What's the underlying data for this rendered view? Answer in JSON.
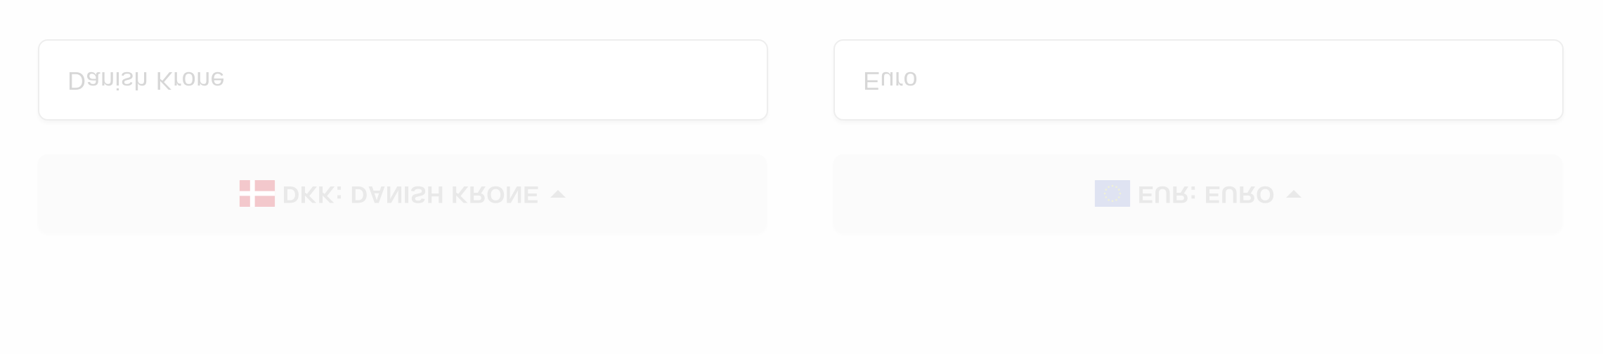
{
  "converter": {
    "from": {
      "input_value": "Danish Krone",
      "select_label": "DKK: DANISH KRONE",
      "flag_icon": "denmark-flag-icon"
    },
    "to": {
      "input_value": "Euro",
      "select_label": "EUR: EURO",
      "flag_icon": "eu-flag-icon"
    }
  },
  "colors": {
    "background": "#fefefe",
    "text_muted": "#d7d7d7",
    "denmark_red": "#f3c8cc",
    "eu_blue": "#dfe3f2"
  }
}
